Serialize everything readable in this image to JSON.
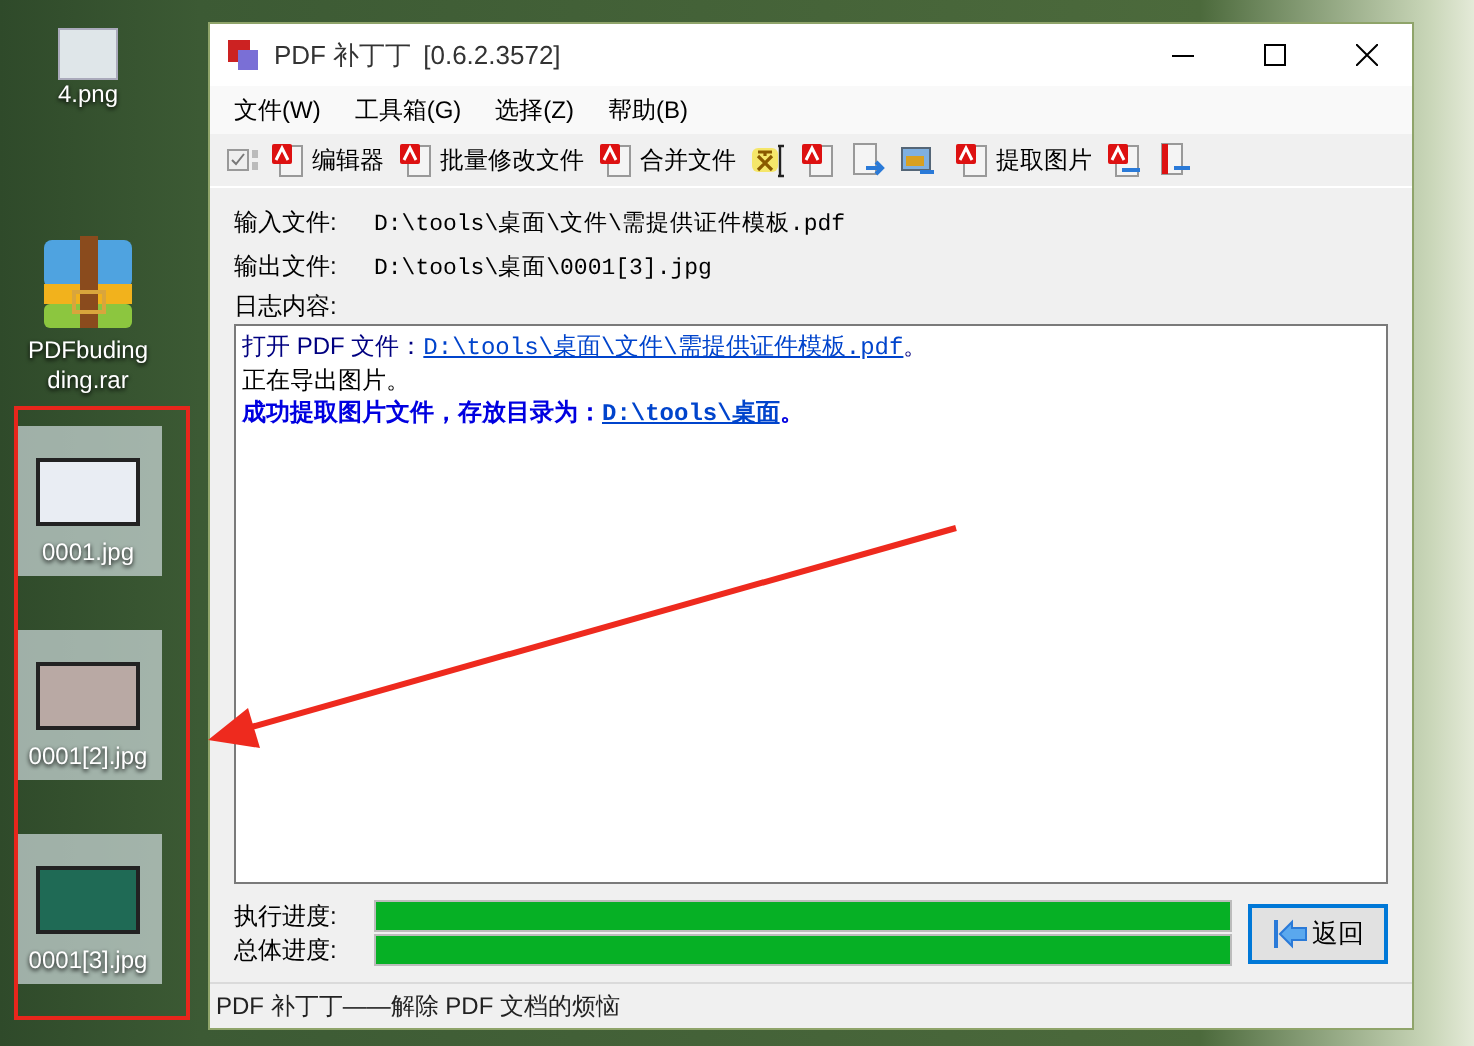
{
  "desktop_icons": [
    {
      "label": "4.png",
      "kind": "image",
      "selected": false
    },
    {
      "label": "PDFbuding ding.rar",
      "kind": "archive",
      "selected": false
    },
    {
      "label": "0001.jpg",
      "kind": "photo",
      "selected": true
    },
    {
      "label": "0001[2].jpg",
      "kind": "photo",
      "selected": true
    },
    {
      "label": "0001[3].jpg",
      "kind": "photo",
      "selected": true
    }
  ],
  "window": {
    "title": "PDF 补丁丁",
    "version": "[0.6.2.3572]"
  },
  "menu": [
    "文件(W)",
    "工具箱(G)",
    "选择(Z)",
    "帮助(B)"
  ],
  "toolbar": [
    {
      "label": "编辑器"
    },
    {
      "label": "批量修改文件"
    },
    {
      "label": "合并文件"
    },
    {
      "label": "提取图片"
    }
  ],
  "fields": [
    {
      "label": "输入文件:",
      "value": "D:\\tools\\桌面\\文件\\需提供证件模板.pdf"
    },
    {
      "label": "输出文件:",
      "value": "D:\\tools\\桌面\\0001[3].jpg"
    }
  ],
  "log": {
    "label": "日志内容:",
    "lines": [
      {
        "kind": "info",
        "text": "打开 PDF 文件：",
        "link": "D:\\tools\\桌面\\文件\\需提供证件模板.pdf",
        "end": "。"
      },
      {
        "kind": "plain",
        "text": "正在导出图片。"
      },
      {
        "kind": "success",
        "text": "成功提取图片文件，存放目录为：",
        "link": "D:\\tools\\桌面",
        "end": "。"
      }
    ]
  },
  "progress": [
    {
      "label": "执行进度:",
      "level": 1
    },
    {
      "label": "总体进度:",
      "level": 1
    }
  ],
  "back_button": "返回",
  "status_bar": "PDF 补丁丁——解除 PDF 文档的烦恼"
}
